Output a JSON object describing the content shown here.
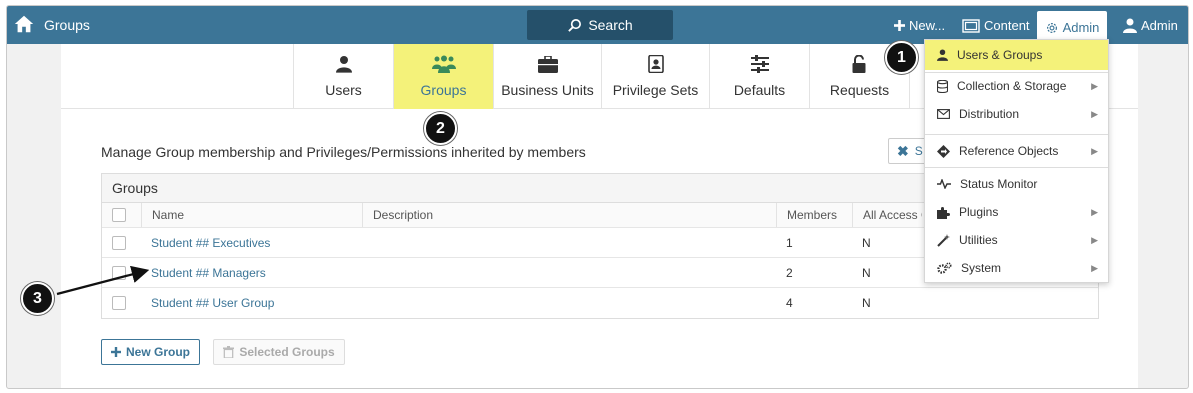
{
  "topbar": {
    "title": "Groups",
    "search_label": "Search",
    "new_label": "New...",
    "content_label": "Content",
    "admin_label": "Admin",
    "user_label": "Admin"
  },
  "tabs": [
    {
      "label": "Users",
      "icon": "user-icon"
    },
    {
      "label": "Groups",
      "icon": "group-icon"
    },
    {
      "label": "Business Units",
      "icon": "briefcase-icon"
    },
    {
      "label": "Privilege Sets",
      "icon": "address-book-icon"
    },
    {
      "label": "Defaults",
      "icon": "sliders-icon"
    },
    {
      "label": "Requests",
      "icon": "unlock-icon"
    }
  ],
  "main": {
    "heading": "Manage Group membership and Privileges/Permissions inherited by members",
    "select_button_label": "S"
  },
  "table": {
    "title": "Groups",
    "columns": [
      "Name",
      "Description",
      "Members",
      "All Access C"
    ],
    "rows": [
      {
        "name": "Student ## Executives",
        "description": "",
        "members": "1",
        "all_access": "N"
      },
      {
        "name": "Student ## Managers",
        "description": "",
        "members": "2",
        "all_access": "N"
      },
      {
        "name": "Student ## User Group",
        "description": "",
        "members": "4",
        "all_access": "N"
      }
    ]
  },
  "buttons": {
    "new_group": "New Group",
    "selected_groups": "Selected Groups"
  },
  "dropdown": {
    "items": [
      {
        "label": "Users & Groups",
        "icon": "user-icon",
        "submenu": false
      },
      {
        "label": "Collection & Storage",
        "icon": "database-icon",
        "submenu": true
      },
      {
        "label": "Distribution",
        "icon": "envelope-icon",
        "submenu": true
      },
      {
        "label": "Reference Objects",
        "icon": "signpost-icon",
        "submenu": true
      },
      {
        "label": "Status Monitor",
        "icon": "pulse-icon",
        "submenu": false
      },
      {
        "label": "Plugins",
        "icon": "puzzle-icon",
        "submenu": true
      },
      {
        "label": "Utilities",
        "icon": "wand-icon",
        "submenu": true
      },
      {
        "label": "System",
        "icon": "cogs-icon",
        "submenu": true
      }
    ]
  },
  "callouts": [
    "1",
    "2",
    "3"
  ],
  "colors": {
    "topbar": "#3c7597",
    "highlight": "#f4f27a",
    "link": "#3c7597"
  }
}
